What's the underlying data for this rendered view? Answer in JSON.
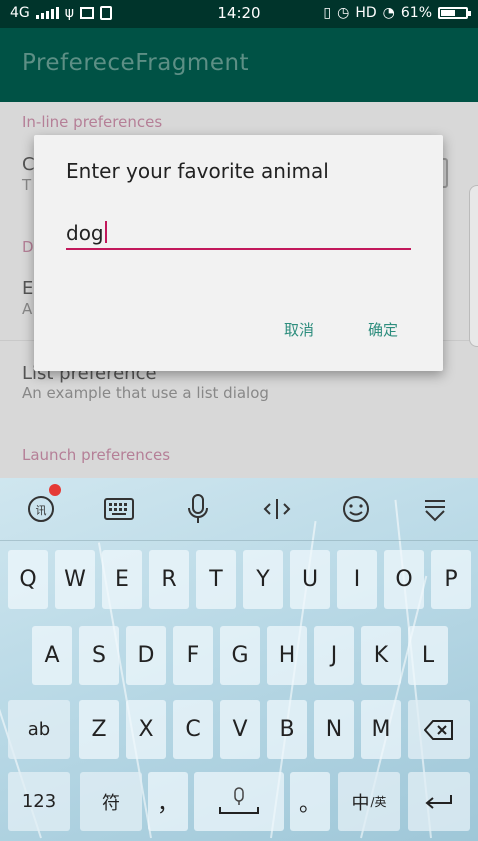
{
  "status_bar": {
    "network": "4G",
    "time": "14:20",
    "hd": "HD",
    "battery_percent": "61%",
    "icons": [
      "signal-icon",
      "usb-icon",
      "grid-icon",
      "sim-icon",
      "vibrate-icon",
      "alarm-icon",
      "wifi-icon",
      "battery-icon"
    ]
  },
  "app_bar": {
    "title": "PrefereceFragment"
  },
  "content": {
    "category_inline": "In-line preferences",
    "pref1_title": "C",
    "pref1_summary": "T",
    "category_dialog": "D",
    "pref2_title": "E",
    "pref2_summary": "A",
    "list_title": "List preference",
    "list_summary": "An example that use a list dialog",
    "category_launch": "Launch preferences"
  },
  "dialog": {
    "title": "Enter your favorite animal",
    "input_value": "dog",
    "cancel_label": "取消",
    "ok_label": "确定",
    "accent_color": "#c2185b",
    "button_color": "#2d8d7d"
  },
  "keyboard": {
    "toolbar_icons": [
      "ime-logo-icon",
      "keyboard-icon",
      "microphone-icon",
      "cursor-move-icon",
      "emoji-icon",
      "hide-keyboard-icon"
    ],
    "row1": [
      "Q",
      "W",
      "E",
      "R",
      "T",
      "Y",
      "U",
      "I",
      "O",
      "P"
    ],
    "row2": [
      "A",
      "S",
      "D",
      "F",
      "G",
      "H",
      "J",
      "K",
      "L"
    ],
    "row3": [
      "Z",
      "X",
      "C",
      "V",
      "B",
      "N",
      "M"
    ],
    "shift_label": "ab",
    "backspace_icon": "backspace-icon",
    "num_label": "123",
    "symbol_label": "符",
    "comma_label": "，",
    "space_icon": "space-mic-icon",
    "period_label": "。",
    "lang_label": "中",
    "lang_sub": "/英",
    "enter_icon": "enter-icon"
  }
}
